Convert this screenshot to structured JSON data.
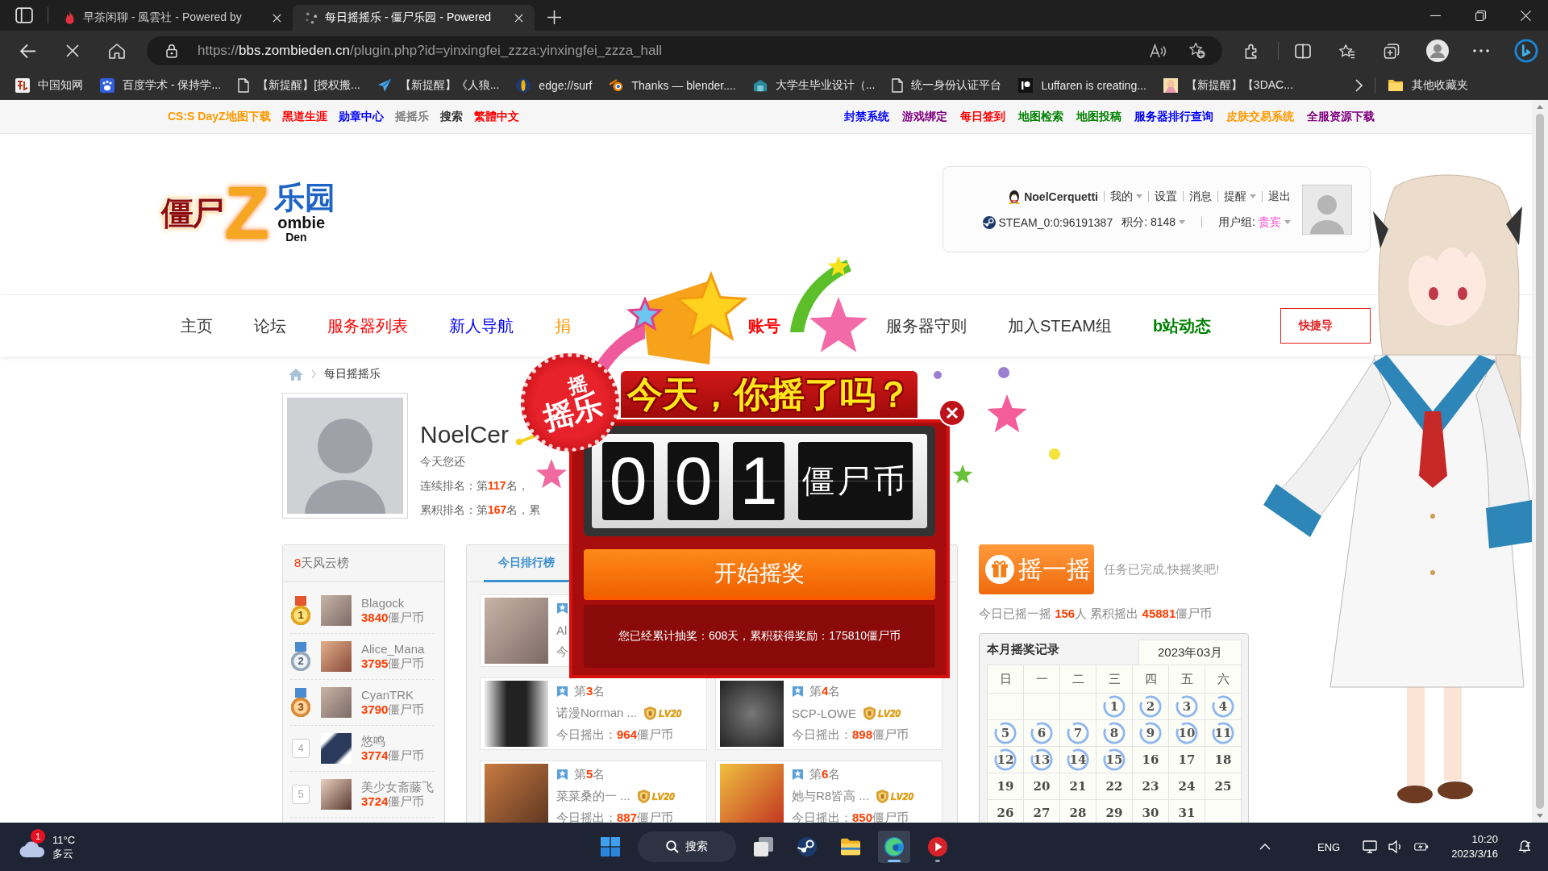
{
  "browser": {
    "tabs": [
      {
        "title": "早茶闲聊 - 風雲社 - Powered by",
        "kind": "flame",
        "selected": false
      },
      {
        "title": "每日摇摇乐 - 僵尸乐园 - Powered",
        "kind": "loading",
        "selected": true
      }
    ],
    "url": {
      "scheme": "https://",
      "host": "bbs.zombieden.cn",
      "path": "/plugin.php?id=yinxingfei_zzza:yinxingfei_zzza_hall"
    },
    "bookmarks": [
      {
        "label": "中国知网",
        "kind": "tile"
      },
      {
        "label": "百度学术 - 保持学...",
        "kind": "paw"
      },
      {
        "label": "【新提醒】[授权搬...",
        "kind": "page"
      },
      {
        "label": "【新提醒】《人狼...",
        "kind": "plane"
      },
      {
        "label": "edge://surf",
        "kind": "surfboard"
      },
      {
        "label": "Thanks — blender....",
        "kind": "ring"
      },
      {
        "label": "大学生毕业设计（...",
        "kind": "building"
      },
      {
        "label": "统一身份认证平台",
        "kind": "page"
      },
      {
        "label": "Luffaren is creating...",
        "kind": "dotbar"
      },
      {
        "label": "【新提醒】【3DAC...",
        "kind": "thumb"
      }
    ],
    "other_bookmarks": "其他收藏夹"
  },
  "site": {
    "top_links_left": [
      {
        "label": "CS:S DayZ地图下载",
        "color": "#ff9900"
      },
      {
        "label": "黑道生涯",
        "color": "#ff0000"
      },
      {
        "label": "勋章中心",
        "color": "#0000ff"
      },
      {
        "label": "摇摇乐",
        "color": "#808080"
      },
      {
        "label": "搜索",
        "color": "#333333"
      },
      {
        "label": "繁體中文",
        "color": "#ff0000"
      }
    ],
    "top_links_right": [
      {
        "label": "封禁系统",
        "color": "#0000ff"
      },
      {
        "label": "游戏绑定",
        "color": "#800080"
      },
      {
        "label": "每日签到",
        "color": "#ff0000"
      },
      {
        "label": "地图检索",
        "color": "#008000"
      },
      {
        "label": "地图投稿",
        "color": "#008000"
      },
      {
        "label": "服务器排行查询",
        "color": "#0000ff"
      },
      {
        "label": "皮肤交易系统",
        "color": "#ff9900"
      },
      {
        "label": "全服资源下载",
        "color": "#800080"
      }
    ],
    "logo": {
      "top": "僵尸",
      "letter": "Z",
      "side": "乐园",
      "word": "ombie",
      "sub": "Den"
    },
    "user_panel": {
      "username": "NoelCerquetti",
      "links": [
        {
          "label": "我的",
          "dropdown": true
        },
        {
          "label": "设置",
          "dropdown": false
        },
        {
          "label": "消息",
          "dropdown": false
        },
        {
          "label": "提醒",
          "dropdown": true
        },
        {
          "label": "退出",
          "dropdown": false
        }
      ],
      "steam_id": "STEAM_0:0:96191387",
      "points": "积分: 8148",
      "group_label": "用户组:",
      "group": "贵宾"
    },
    "nav": {
      "items": [
        {
          "label": "主页",
          "color": "#333333",
          "bold": false
        },
        {
          "label": "论坛",
          "color": "#333333",
          "bold": false
        },
        {
          "label": "服务器列表",
          "color": "#ff0000",
          "bold": false
        },
        {
          "label": "新人导航",
          "color": "#0000ff",
          "bold": false
        },
        {
          "label": "捐",
          "color": "#ff9900",
          "bold": false
        },
        {
          "label": "账号",
          "color": "#ff0000",
          "bold": true
        },
        {
          "label": "服务器守则",
          "color": "#333333",
          "bold": false
        },
        {
          "label": "加入STEAM组",
          "color": "#333333",
          "bold": false
        },
        {
          "label": "b站动态",
          "color": "#008000",
          "bold": true
        }
      ],
      "quick_nav": "快捷导"
    },
    "breadcrumb": "每日摇摇乐",
    "profile": {
      "name": "NoelCer",
      "lines": [
        "今天您还",
        "连续排名：第**117**名，",
        "累积排名：第**167**名，累"
      ]
    },
    "weekly_board": {
      "title": "**8**天风云榜",
      "rows": [
        {
          "rank": "1",
          "kind": "gold",
          "name": "Blagock",
          "score": "**3840**僵尸币"
        },
        {
          "rank": "2",
          "kind": "silver",
          "name": "Alice_Mana",
          "score": "**3795**僵尸币"
        },
        {
          "rank": "3",
          "kind": "bronze",
          "name": "CyanTRK",
          "score": "**3790**僵尸币"
        },
        {
          "rank": "4",
          "kind": "plain",
          "name": "悠鸣",
          "score": "**3774**僵尸币"
        },
        {
          "rank": "5",
          "kind": "plain",
          "name": "美少女斋藤飞",
          "score": "**3724**僵尸币"
        }
      ]
    },
    "today_board": {
      "tabs": [
        {
          "label": "今日排行榜",
          "selected": true
        }
      ],
      "card_rows": [
        [
          {
            "name": "Al",
            "detail": "今"
          }
        ],
        [
          {
            "place": "第**3**名",
            "name": "诺漫Norman ...",
            "level": "LV20",
            "detail": "今日摇出：**964**僵尸币"
          },
          {
            "place": "第**4**名",
            "name": "SCP-LOWE",
            "level": "LV20",
            "detail": "今日摇出：**898**僵尸币"
          }
        ],
        [
          {
            "place": "第**5**名",
            "name": "菜菜桑的一 ...",
            "level": "LV20",
            "detail": "今日摇出：**887**僵尸币"
          },
          {
            "place": "第**6**名",
            "name": "她与R8皆高 ...",
            "level": "LV20",
            "detail": "今日摇出：**850**僵尸币"
          }
        ]
      ]
    },
    "lottery": {
      "button": "摇一摇",
      "status": "任务已完成,快摇奖吧!",
      "stats": "今日已摇一摇 **156**人 累积摇出 **45881**僵尸币",
      "calendar": {
        "title": "本月摇奖记录",
        "month": "2023年03月",
        "weekdays": [
          "日",
          "一",
          "二",
          "三",
          "四",
          "五",
          "六"
        ],
        "weeks": [
          [
            {
              "day": "1",
              "checked": true
            },
            {
              "day": "2",
              "checked": true
            },
            {
              "day": "3",
              "checked": true
            },
            {
              "day": "4",
              "checked": true
            }
          ],
          [
            {
              "day": "5",
              "checked": true
            },
            {
              "day": "6",
              "checked": true
            },
            {
              "day": "7",
              "checked": true
            },
            {
              "day": "8",
              "checked": true
            },
            {
              "day": "9",
              "checked": true
            },
            {
              "day": "10",
              "checked": true
            },
            {
              "day": "11",
              "checked": true
            }
          ],
          [
            {
              "day": "12",
              "checked": true
            },
            {
              "day": "13",
              "checked": true
            },
            {
              "day": "14",
              "checked": true
            },
            {
              "day": "15",
              "checked": true
            },
            {
              "day": "16",
              "checked": false
            },
            {
              "day": "17",
              "checked": false
            },
            {
              "day": "18",
              "checked": false
            }
          ],
          [
            {
              "day": "19",
              "checked": false
            },
            {
              "day": "20",
              "checked": false
            },
            {
              "day": "21",
              "checked": false
            },
            {
              "day": "22",
              "checked": false
            },
            {
              "day": "23",
              "checked": false
            },
            {
              "day": "24",
              "checked": false
            },
            {
              "day": "25",
              "checked": false
            }
          ],
          [
            {
              "day": "26",
              "checked": false
            },
            {
              "day": "27",
              "checked": false
            },
            {
              "day": "28",
              "checked": false
            },
            {
              "day": "29",
              "checked": false
            },
            {
              "day": "30",
              "checked": false
            },
            {
              "day": "31",
              "checked": false
            }
          ]
        ]
      }
    },
    "popup": {
      "badge_top": "摇",
      "badge_main": "摇乐",
      "title": "今天，你摇了吗？",
      "digits": [
        "0",
        "0",
        "1"
      ],
      "unit": "僵尸币",
      "button": "开始摇奖",
      "summary": "您已经累计抽奖：608天，累积获得奖励：175810僵尸币"
    }
  },
  "taskbar": {
    "weather": {
      "alerts": "1",
      "temperature": "11°C",
      "condition": "多云"
    },
    "apps": [
      {
        "kind": "start",
        "running": false,
        "selected": false
      },
      {
        "kind": "search",
        "label": "搜索",
        "running": false,
        "selected": false
      },
      {
        "kind": "taskview",
        "running": false,
        "selected": false
      },
      {
        "kind": "steam",
        "running": false,
        "selected": false
      },
      {
        "kind": "explorer",
        "running": false,
        "selected": false
      },
      {
        "kind": "edge",
        "running": true,
        "selected": true
      },
      {
        "kind": "player",
        "running": true,
        "selected": false
      }
    ],
    "language": "ENG",
    "time": "10:20",
    "date": "2023/3/16"
  }
}
